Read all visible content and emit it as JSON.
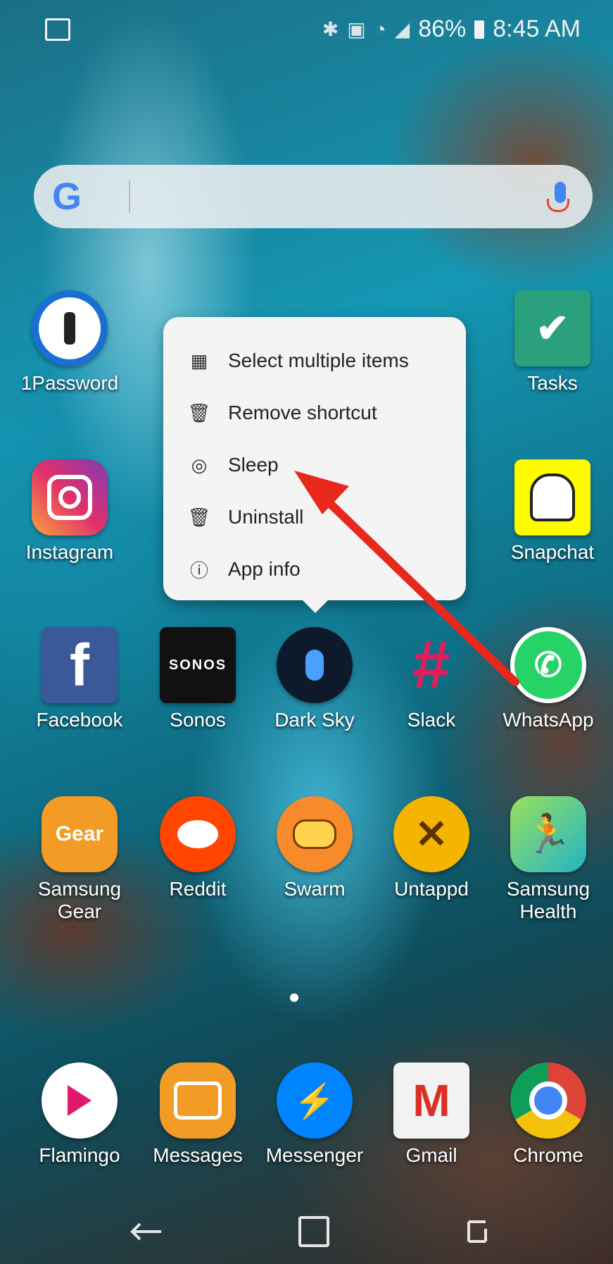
{
  "status_bar": {
    "battery_percent": "86%",
    "time": "8:45 AM",
    "icons": [
      "image-notification-icon",
      "bluetooth-icon",
      "nfc-icon",
      "wifi-icon",
      "signal-icon",
      "battery-icon"
    ]
  },
  "search": {
    "placeholder": "",
    "logo": "G",
    "icons": [
      "google-g-icon",
      "microphone-icon"
    ]
  },
  "context_menu": {
    "items": [
      {
        "label": "Select multiple items",
        "icon": "select-multiple-icon"
      },
      {
        "label": "Remove shortcut",
        "icon": "trash-icon"
      },
      {
        "label": "Sleep",
        "icon": "sleep-icon"
      },
      {
        "label": "Uninstall",
        "icon": "uninstall-icon"
      },
      {
        "label": "App info",
        "icon": "info-icon"
      }
    ]
  },
  "apps": {
    "row1": [
      {
        "label": "1Password"
      },
      {
        "label": "Tasks"
      }
    ],
    "row2": [
      {
        "label": "Instagram"
      },
      {
        "label": "Snapchat"
      }
    ],
    "row3": [
      {
        "label": "Facebook"
      },
      {
        "label": "Sonos"
      },
      {
        "label": "Dark Sky"
      },
      {
        "label": "Slack"
      },
      {
        "label": "WhatsApp"
      }
    ],
    "row4": [
      {
        "label": "Samsung Gear"
      },
      {
        "label": "Reddit"
      },
      {
        "label": "Swarm"
      },
      {
        "label": "Untappd"
      },
      {
        "label": "Samsung Health"
      }
    ],
    "dock": [
      {
        "label": "Flamingo"
      },
      {
        "label": "Messages"
      },
      {
        "label": "Messenger"
      },
      {
        "label": "Gmail"
      },
      {
        "label": "Chrome"
      }
    ]
  },
  "icon_text": {
    "sonos": "SONOS",
    "gear": "Gear",
    "facebook": "f"
  },
  "nav_bar": {
    "icons": [
      "back-icon",
      "home-icon",
      "recents-icon"
    ]
  },
  "colors": {
    "annotation_arrow": "#e8281c",
    "menu_background": "#f4f4f4"
  }
}
